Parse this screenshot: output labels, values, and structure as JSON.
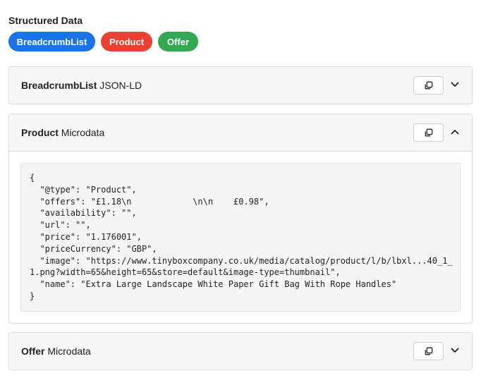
{
  "section_title": "Structured Data",
  "pills": [
    {
      "label": "BreadcrumbList",
      "color": "#1a73e8"
    },
    {
      "label": "Product",
      "color": "#e94235"
    },
    {
      "label": "Offer",
      "color": "#34a853"
    }
  ],
  "panels": [
    {
      "name": "BreadcrumbList",
      "format": "JSON-LD",
      "expanded": false,
      "chevron": "chevron-down-icon"
    },
    {
      "name": "Product",
      "format": "Microdata",
      "expanded": true,
      "chevron": "chevron-up-icon"
    },
    {
      "name": "Offer",
      "format": "Microdata",
      "expanded": false,
      "chevron": "chevron-down-icon"
    }
  ],
  "product_code": {
    "lines": [
      "{",
      "  \"@type\": \"Product\",",
      "  \"offers\": \"£1.18\\n            \\n\\n    £0.98\",",
      "  \"availability\": \"\",",
      "  \"url\": \"\",",
      "  \"price\": \"1.176001\",",
      "  \"priceCurrency\": \"GBP\",",
      "  \"image\": \"https://www.tinyboxcompany.co.uk/media/catalog/product/l/b/lbxl...40_1_",
      "1.png?width=65&height=65&store=default&image-type=thumbnail\",",
      "  \"name\": \"Extra Large Landscape White Paper Gift Bag With Rope Handles\"",
      "}"
    ]
  }
}
